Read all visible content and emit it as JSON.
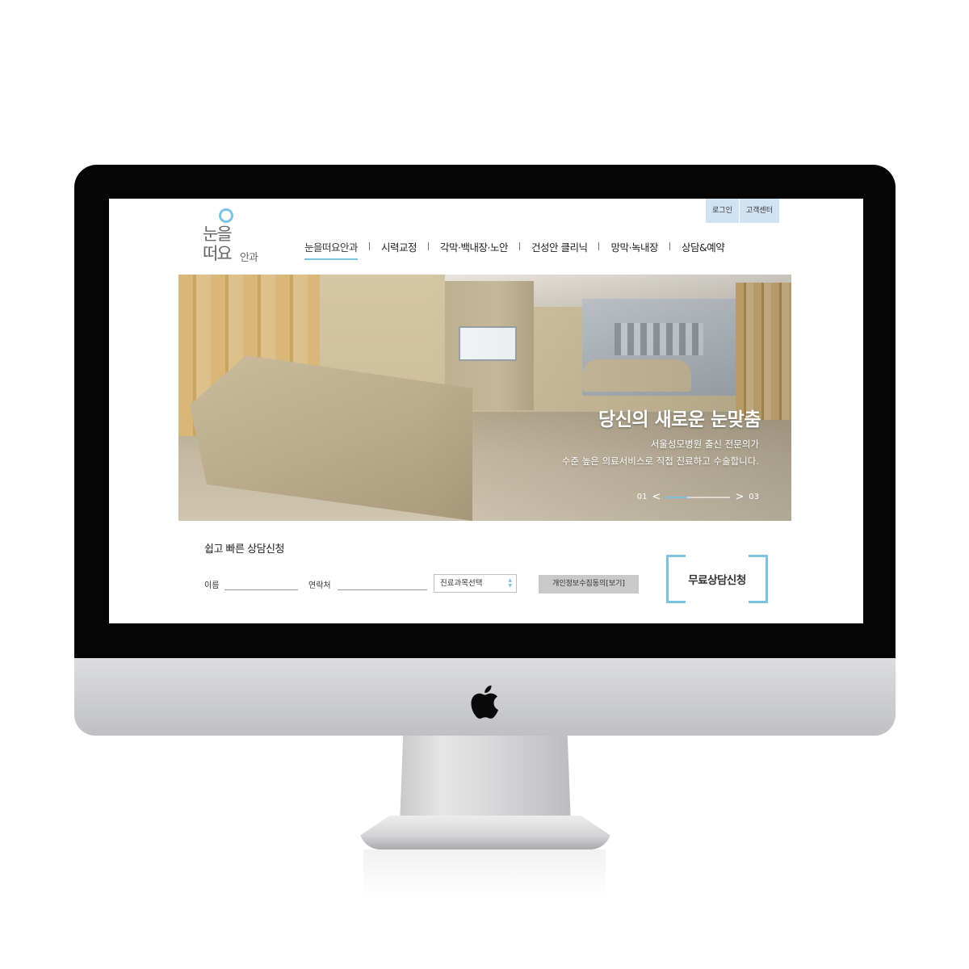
{
  "site": {
    "util_nav": [
      "로그인",
      "고객센터"
    ],
    "logo": {
      "line1": "눈을",
      "line2": "떠요",
      "small": "안과"
    },
    "gnb": [
      "눈을떠요안과",
      "시력교정",
      "각막·백내장·노안",
      "건성안 클리닉",
      "망막·녹내장",
      "상담&예약"
    ],
    "active_gnb_index": 0,
    "hero": {
      "title": "당신의 새로운 눈맞춤",
      "sub1": "서울성모병원 출신 전문의가",
      "sub2": "수준 높은 의료서비스로 직접 진료하고 수술합니다.",
      "pager_start": "01",
      "pager_end": "03",
      "pager_prev": "<",
      "pager_next": ">",
      "progress": 0.33
    },
    "consult": {
      "title": "쉽고 빠른 상담신청",
      "name_label": "이름",
      "phone_label": "연락처",
      "select_value": "진료과목선택",
      "privacy_label": "개인정보수집동의[보기]",
      "submit_label": "무료상담신청"
    }
  },
  "colors": {
    "accent": "#7ac4df",
    "util_bg": "#cfe3f3",
    "bezel": "#050505"
  },
  "icons": [
    "apple-logo-icon",
    "select-arrows-icon",
    "chevron-left-icon",
    "chevron-right-icon"
  ]
}
